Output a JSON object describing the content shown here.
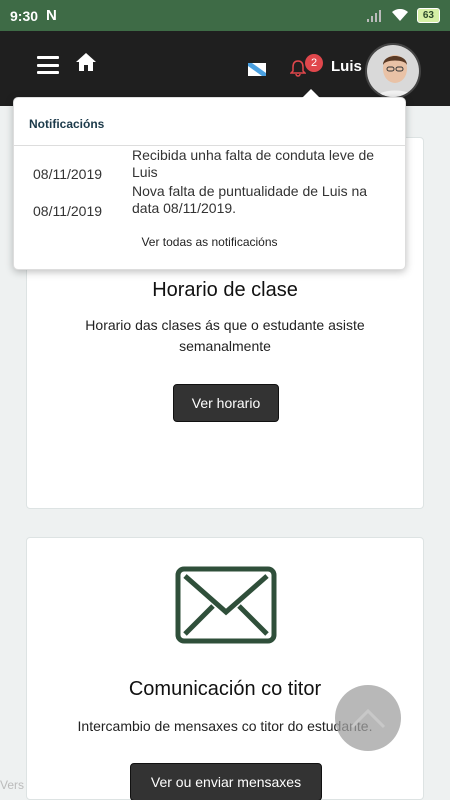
{
  "statusbar": {
    "time": "9:30",
    "battery": "63"
  },
  "header": {
    "username": "Luis",
    "badge_count": "2"
  },
  "notifications": {
    "title": "Notificacións",
    "items": [
      {
        "date": "08/11/2019",
        "message": "Recibida unha falta de conduta leve de Luis"
      },
      {
        "date": "08/11/2019",
        "message": "Nova falta de puntualidade de Luis na data 08/11/2019."
      }
    ],
    "see_all": "Ver todas as notificacións"
  },
  "cards": {
    "schedule": {
      "title": "Horario de clase",
      "description": "Horario das clases ás que o estudante asiste semanalmente",
      "button": "Ver horario"
    },
    "messages": {
      "title": "Comunicación co titor",
      "description": "Intercambio de mensaxes co titor do estudante.",
      "button": "Ver ou enviar mensaxes"
    }
  },
  "footer": {
    "version": "Vers"
  },
  "colors": {
    "statusbar": "#3e6b46",
    "appbar": "#1f1f1f",
    "badge": "#e0474c",
    "button": "#333333",
    "envelope": "#2f4f3a"
  }
}
